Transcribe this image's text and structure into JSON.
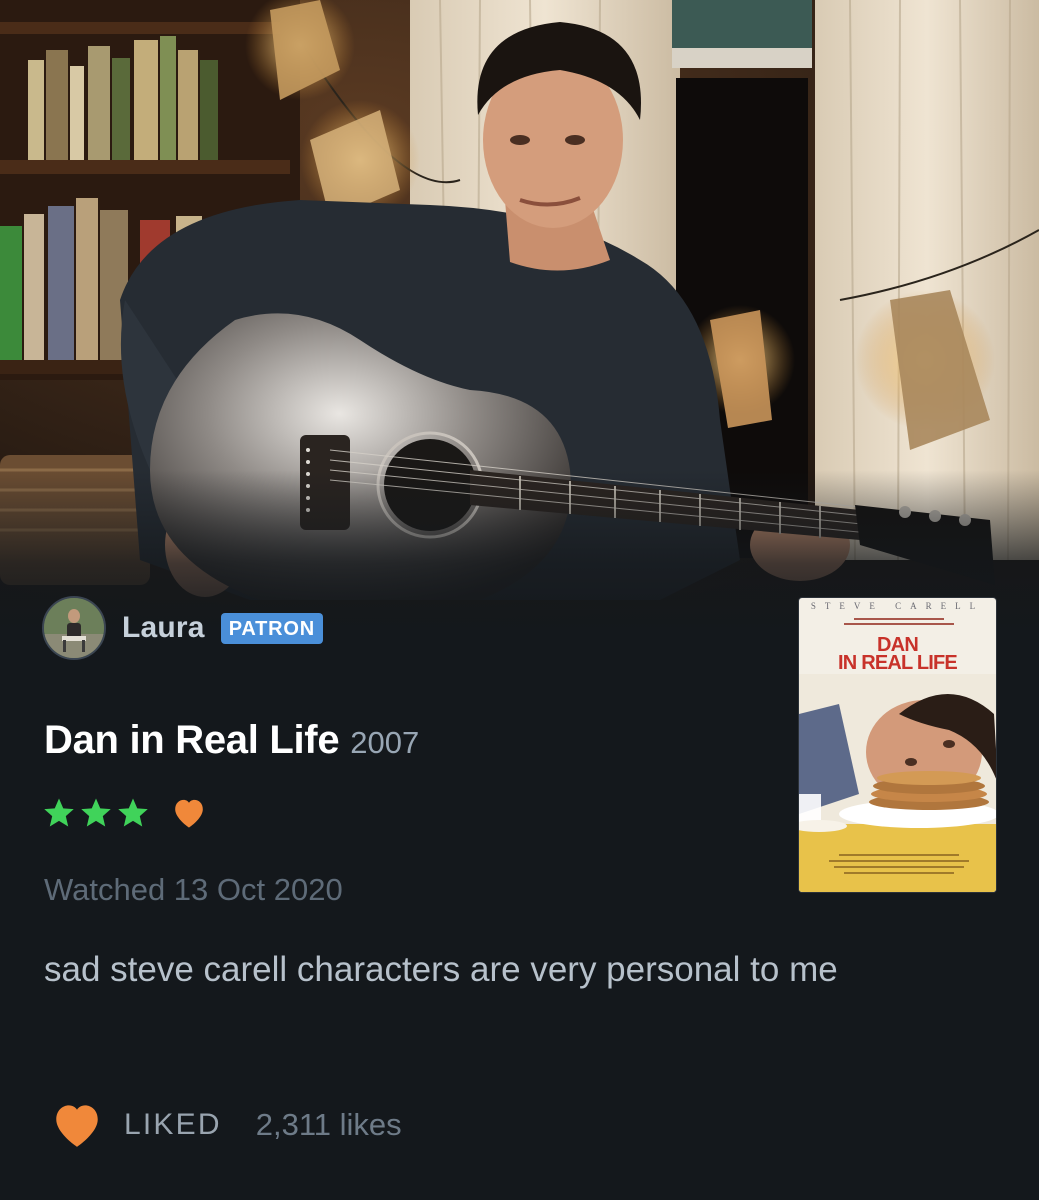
{
  "reviewer": {
    "name": "Laura",
    "badge": "PATRON"
  },
  "film": {
    "title": "Dan in Real Life",
    "year": "2007"
  },
  "rating": {
    "stars": 3,
    "liked": true,
    "star_color": "#40d35a",
    "heart_color": "#f0883a"
  },
  "watched": "Watched 13 Oct 2020",
  "review": "sad steve carell characters are very personal to me",
  "likes": {
    "label": "LIKED",
    "count": "2,311 likes"
  },
  "poster": {
    "actor": "STEVE CARELL",
    "title_line1": "DAN",
    "title_line2": "IN REAL LIFE"
  },
  "colors": {
    "background": "#14181c",
    "patron_badge": "#4a8fd9",
    "accent_orange": "#f0883a",
    "accent_green": "#40d35a"
  }
}
